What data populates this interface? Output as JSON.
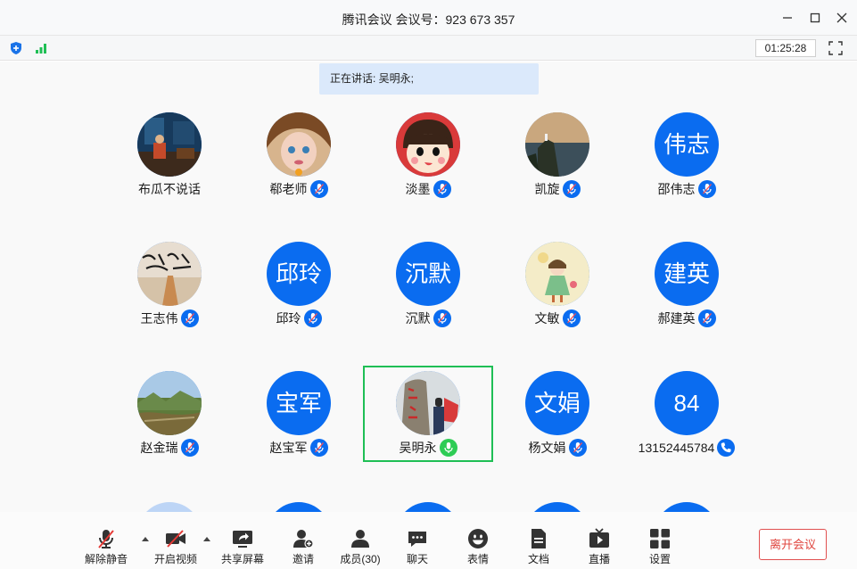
{
  "window": {
    "title": "腾讯会议 会议号：923 673 357"
  },
  "status": {
    "timer": "01:25:28"
  },
  "speaking_banner": "正在讲话: 吴明永;",
  "participants": [
    {
      "name": "布瓜不说话",
      "avatar": "photo-interior",
      "mic": "none"
    },
    {
      "name": "郗老师",
      "avatar": "photo-cartoon-girl",
      "mic": "muted"
    },
    {
      "name": "淡墨",
      "avatar": "photo-peko-doll",
      "mic": "muted"
    },
    {
      "name": "凯旋",
      "avatar": "photo-coast",
      "mic": "muted"
    },
    {
      "name": "邵伟志",
      "avatar_text": "伟志",
      "mic": "muted"
    },
    {
      "name": "王志伟",
      "avatar": "photo-calligraphy",
      "mic": "muted"
    },
    {
      "name": "邱玲",
      "avatar_text": "邱玲",
      "mic": "muted"
    },
    {
      "name": "沉默",
      "avatar_text": "沉默",
      "mic": "muted"
    },
    {
      "name": "文敏",
      "avatar": "photo-paper-girl",
      "mic": "muted"
    },
    {
      "name": "郝建英",
      "avatar_text": "建英",
      "mic": "muted"
    },
    {
      "name": "赵金瑞",
      "avatar": "photo-mountains",
      "mic": "muted"
    },
    {
      "name": "赵宝军",
      "avatar_text": "宝军",
      "mic": "muted"
    },
    {
      "name": "吴明永",
      "avatar": "photo-stone-monument",
      "mic": "speaking",
      "active": true
    },
    {
      "name": "杨文娟",
      "avatar_text": "文娟",
      "mic": "muted"
    },
    {
      "name": "13152445784",
      "avatar_text": "84",
      "mic": "phone"
    }
  ],
  "toolbar": {
    "unmute": "解除静音",
    "start_video": "开启视频",
    "share_screen": "共享屏幕",
    "invite": "邀请",
    "members": "成员(30)",
    "chat": "聊天",
    "reactions": "表情",
    "documents": "文档",
    "live": "直播",
    "settings": "设置",
    "leave": "离开会议"
  },
  "colors": {
    "accent": "#0a6cf0",
    "speaking": "#1fbf55",
    "leave": "#e0463f",
    "banner": "#dbe9fb"
  }
}
